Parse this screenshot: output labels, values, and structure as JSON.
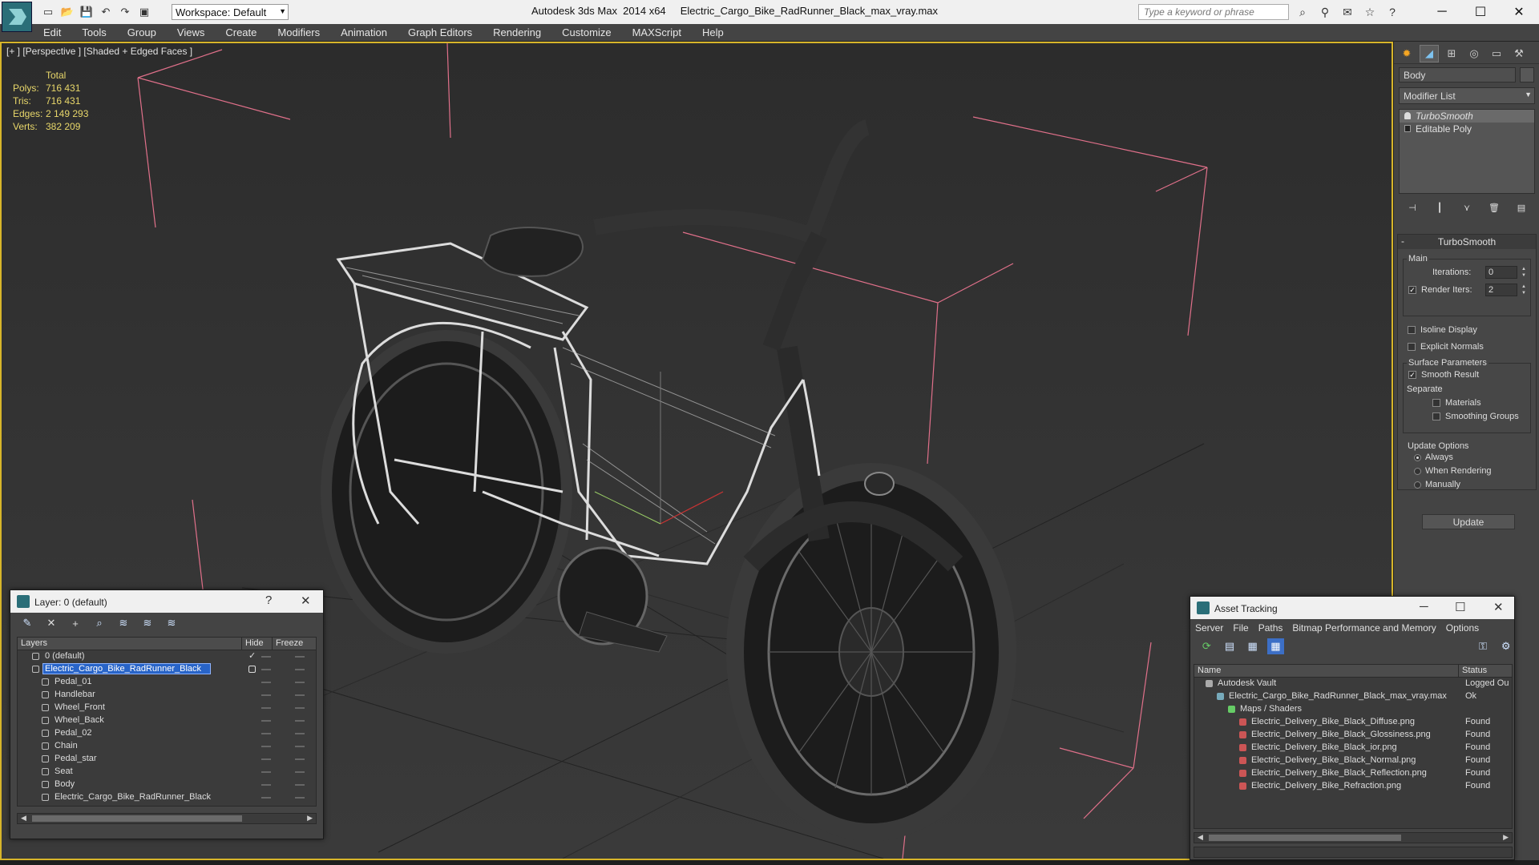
{
  "titlebar": {
    "app_name": "Autodesk 3ds Max  2014 x64",
    "file_name": "Electric_Cargo_Bike_RadRunner_Black_max_vray.max",
    "workspace": "Workspace: Default",
    "search_placeholder": "Type a keyword or phrase"
  },
  "menu": [
    "Edit",
    "Tools",
    "Group",
    "Views",
    "Create",
    "Modifiers",
    "Animation",
    "Graph Editors",
    "Rendering",
    "Customize",
    "MAXScript",
    "Help"
  ],
  "viewport": {
    "label": "[+ ] [Perspective ] [Shaded + Edged Faces ]",
    "stats": {
      "header": "Total",
      "rows": [
        {
          "label": "Polys:",
          "value": "716 431"
        },
        {
          "label": "Tris:",
          "value": "716 431"
        },
        {
          "label": "Edges:",
          "value": "2 149 293"
        },
        {
          "label": "Verts:",
          "value": "382 209"
        }
      ]
    }
  },
  "command_panel": {
    "object_name": "Body",
    "modifier_list": "Modifier List",
    "stack": [
      "TurboSmooth",
      "Editable Poly"
    ],
    "rollout_title": "TurboSmooth",
    "main_label": "Main",
    "iterations_label": "Iterations:",
    "iterations_value": "0",
    "render_iters_label": "Render Iters:",
    "render_iters_value": "2",
    "isoline": "Isoline Display",
    "explicit_normals": "Explicit Normals",
    "surface_params": "Surface Parameters",
    "smooth_result": "Smooth Result",
    "separate": "Separate",
    "materials": "Materials",
    "smoothing_groups": "Smoothing Groups",
    "update_options": "Update Options",
    "always": "Always",
    "when_rendering": "When Rendering",
    "manually": "Manually",
    "update_button": "Update"
  },
  "layer_panel": {
    "title": "Layer: 0 (default)",
    "col_layers": "Layers",
    "col_hide": "Hide",
    "col_freeze": "Freeze",
    "rows": [
      {
        "name": "0 (default)",
        "level": 1,
        "active": true
      },
      {
        "name": "Electric_Cargo_Bike_RadRunner_Black",
        "level": 1,
        "selected": true
      },
      {
        "name": "Pedal_01",
        "level": 2
      },
      {
        "name": "Handlebar",
        "level": 2
      },
      {
        "name": "Wheel_Front",
        "level": 2
      },
      {
        "name": "Wheel_Back",
        "level": 2
      },
      {
        "name": "Pedal_02",
        "level": 2
      },
      {
        "name": "Chain",
        "level": 2
      },
      {
        "name": "Pedal_star",
        "level": 2
      },
      {
        "name": "Seat",
        "level": 2
      },
      {
        "name": "Body",
        "level": 2
      },
      {
        "name": "Electric_Cargo_Bike_RadRunner_Black",
        "level": 2
      }
    ]
  },
  "asset_panel": {
    "title": "Asset Tracking",
    "menu": [
      "Server",
      "File",
      "Paths",
      "Bitmap Performance and Memory",
      "Options"
    ],
    "col_name": "Name",
    "col_status": "Status",
    "rows": [
      {
        "name": "Autodesk Vault",
        "status": "Logged Ou",
        "level": 1
      },
      {
        "name": "Electric_Cargo_Bike_RadRunner_Black_max_vray.max",
        "status": "Ok",
        "level": 2
      },
      {
        "name": "Maps / Shaders",
        "status": "",
        "level": 3
      },
      {
        "name": "Electric_Delivery_Bike_Black_Diffuse.png",
        "status": "Found",
        "level": 4
      },
      {
        "name": "Electric_Delivery_Bike_Black_Glossiness.png",
        "status": "Found",
        "level": 4
      },
      {
        "name": "Electric_Delivery_Bike_Black_ior.png",
        "status": "Found",
        "level": 4
      },
      {
        "name": "Electric_Delivery_Bike_Black_Normal.png",
        "status": "Found",
        "level": 4
      },
      {
        "name": "Electric_Delivery_Bike_Black_Reflection.png",
        "status": "Found",
        "level": 4
      },
      {
        "name": "Electric_Delivery_Bike_Refraction.png",
        "status": "Found",
        "level": 4
      }
    ]
  },
  "colors": {
    "viewport_border": "#d7b52a",
    "stats_text": "#e8d76a",
    "bbox_lines": "#e0708a",
    "selection": "#2864c8"
  }
}
